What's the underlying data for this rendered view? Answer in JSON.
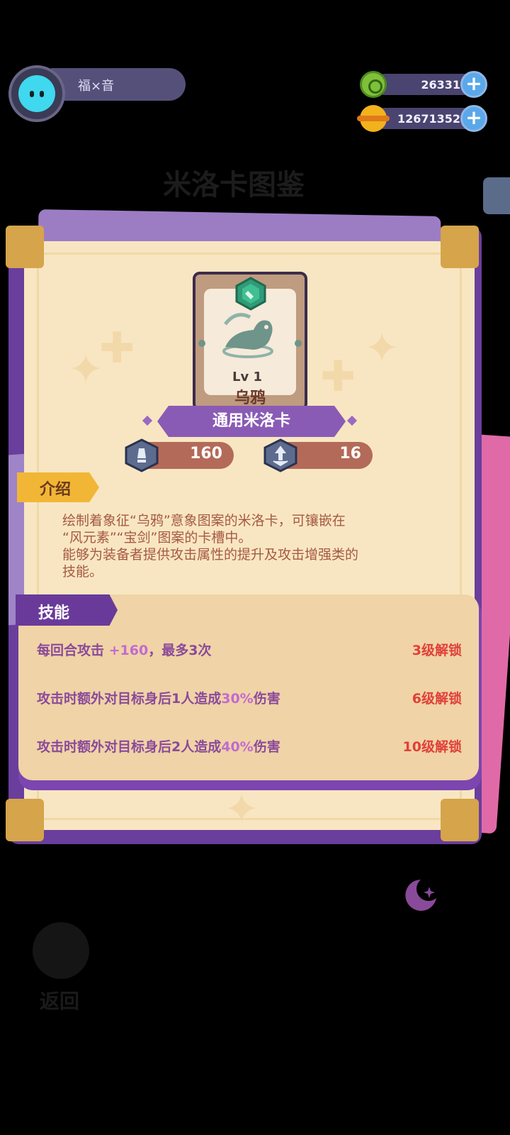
{
  "player": {
    "name": "福×音"
  },
  "currencies": [
    {
      "name": "green-coin",
      "value": "26331",
      "color": "#7fbf3a"
    },
    {
      "name": "gold-planet",
      "value": "12671352",
      "color": "#f2b21c"
    }
  ],
  "background": {
    "title": "米洛卡图鉴",
    "back_label": "返回"
  },
  "card": {
    "level": "Lv 1",
    "name": "乌鸦",
    "type": "通用米洛卡",
    "stats": [
      {
        "icon": "attack-icon",
        "value": "160"
      },
      {
        "icon": "defense-icon",
        "value": "16"
      }
    ]
  },
  "intro": {
    "label": "介绍",
    "lines": [
      "绘制着象征“乌鸦”意象图案的米洛卡，可镶嵌在",
      "“风元素”“宝剑”图案的卡槽中。",
      "能够为装备者提供攻击属性的提升及攻击增强类的",
      "技能。"
    ]
  },
  "skills": {
    "label": "技能",
    "items": [
      {
        "pre": "每回合攻击 ",
        "hl": "+160",
        "post": "，最多3次",
        "unlock": "3级解锁"
      },
      {
        "pre": "攻击时额外对目标身后1人造成",
        "hl": "30%",
        "post": "伤害",
        "unlock": "6级解锁"
      },
      {
        "pre": "攻击时额外对目标身后2人造成",
        "hl": "40%",
        "post": "伤害",
        "unlock": "10级解锁"
      }
    ]
  },
  "colors": {
    "book": "#6a3e9c",
    "paper": "#f8e6c2",
    "accent_red": "#e0403a",
    "tag_gold": "#f2b636"
  }
}
